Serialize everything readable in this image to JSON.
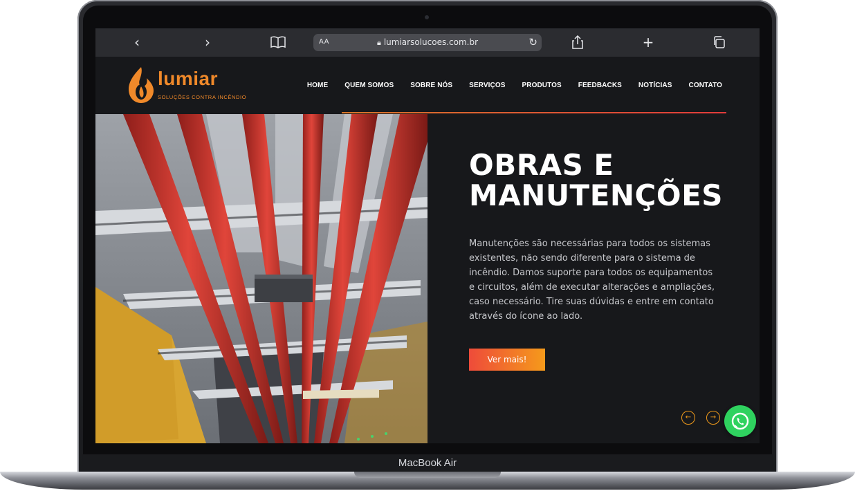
{
  "browser": {
    "back_icon": "chevron-left-icon",
    "forward_icon": "chevron-right-icon",
    "bookmarks_icon": "book-icon",
    "text_size_label": "AA",
    "url": "lumiarsolucoes.com.br",
    "share_icon": "share-icon",
    "new_tab_icon": "plus-icon",
    "tabs_icon": "tabs-icon"
  },
  "site": {
    "logo": {
      "name": "lumiar",
      "tagline": "SOLUÇÕES CONTRA INCÊNDIO"
    },
    "nav": [
      "HOME",
      "QUEM SOMOS",
      "SOBRE NÓS",
      "SERVIÇOS",
      "PRODUTOS",
      "FEEDBACKS",
      "NOTÍCIAS",
      "CONTATO"
    ],
    "hero": {
      "title": "OBRAS E MANUTENÇÕES",
      "description": "Manutenções são necessárias para todos os sistemas existentes, não sendo diferente para o sistema de incêndio. Damos suporte para todos os equipamentos e circuitos, além de executar alterações e ampliações, caso necessário. Tire suas dúvidas e entre em contato através do ícone ao lado.",
      "button_label": "Ver mais!"
    },
    "accent_colors": [
      "#ee4b3a",
      "#f59a1b",
      "#f0892a"
    ],
    "whatsapp_icon": "whatsapp-icon"
  },
  "device": {
    "label": "MacBook Air"
  }
}
